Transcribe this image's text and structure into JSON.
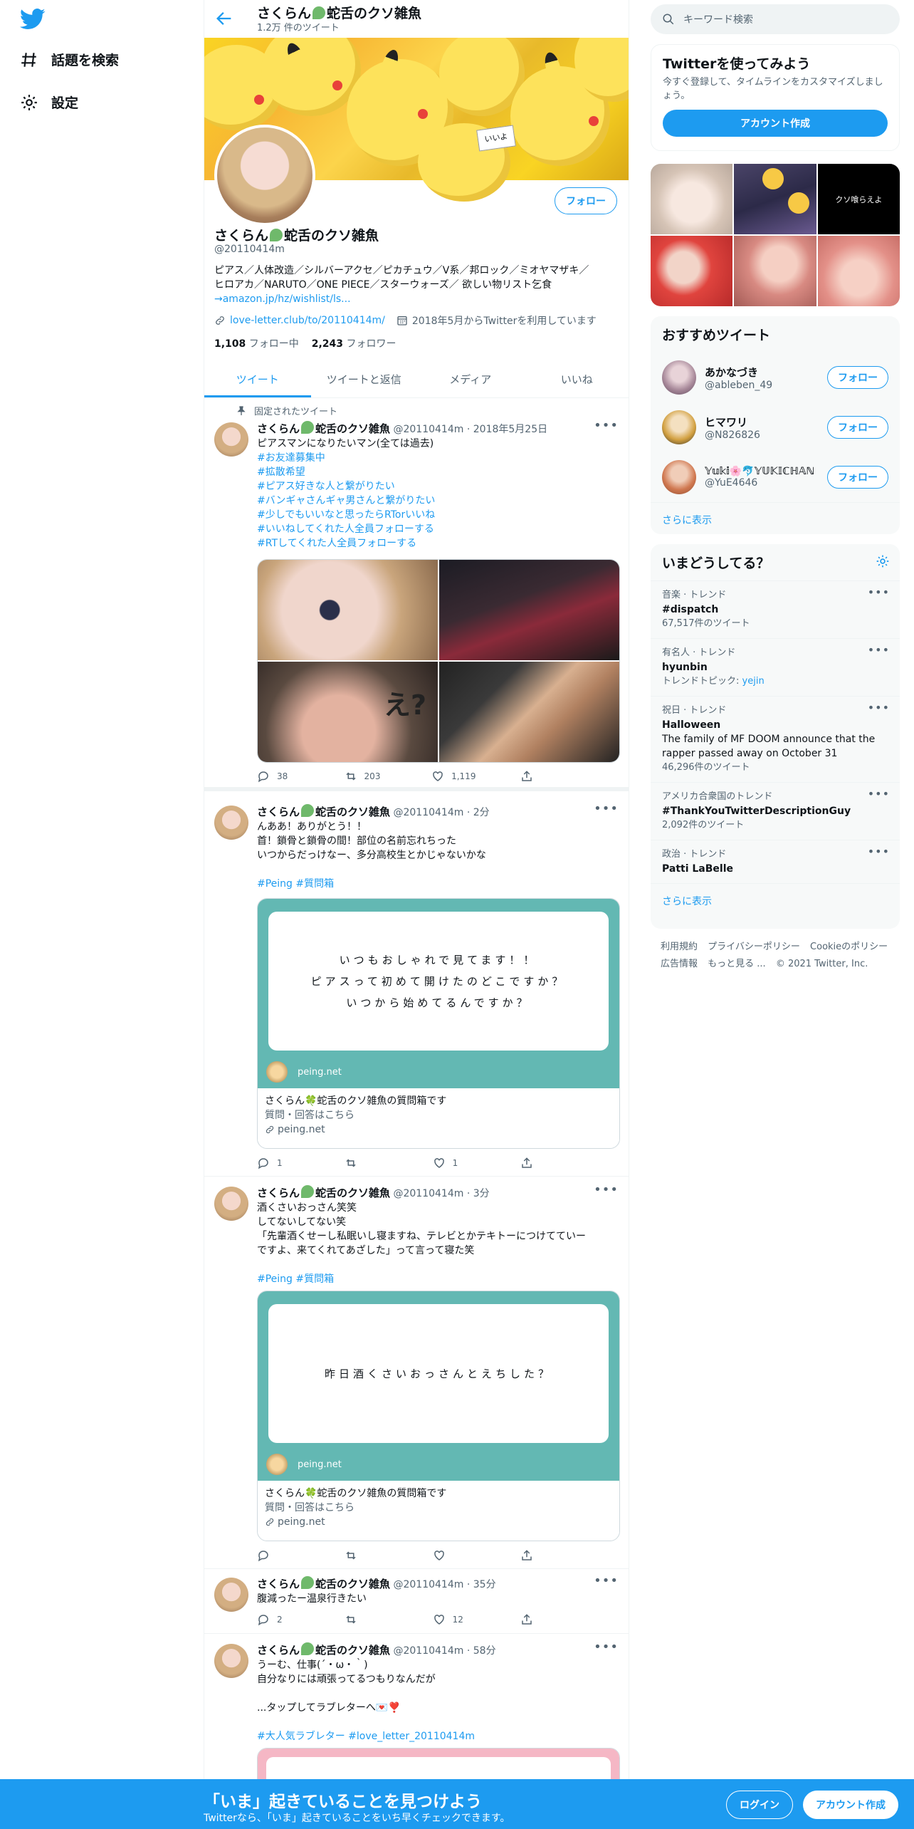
{
  "left_nav": {
    "items": [
      {
        "label": "話題を検索",
        "icon": "hashtag-icon"
      },
      {
        "label": "設定",
        "icon": "gear-icon"
      }
    ]
  },
  "profile": {
    "header_name": "さくらん🍀蛇舌のクソ雑魚",
    "name_prefix": "さくらん",
    "name_suffix": "蛇舌のクソ雑魚",
    "tweet_count": "1.2万 件のツイート",
    "handle": "@20110414m",
    "follow_label": "フォロー",
    "bio_line1": "ピアス／人体改造／シルバーアクセ／ピカチュウ／V系／邦ロック／ミオヤマザキ／",
    "bio_line2": "ヒロアカ／NARUTO／ONE PIECE／スターウォーズ／ 欲しい物リスト乞食",
    "bio_link": "→amazon.jp/hz/wishlist/ls...",
    "website": "love-letter.club/to/20110414m/",
    "joined": "2018年5月からTwitterを利用しています",
    "following_count": "1,108",
    "following_label": "フォロー中",
    "followers_count": "2,243",
    "followers_label": "フォロワー",
    "banner_note": "いいよ"
  },
  "tabs": [
    "ツイート",
    "ツイートと返信",
    "メディア",
    "いいね"
  ],
  "tweets": [
    {
      "pinned_label": "固定されたツイート",
      "handle": "@20110414m",
      "time": "2018年5月25日",
      "lines": [
        "ピアスマンになりたいマン(全ては過去)"
      ],
      "tags": [
        "#お友達募集中",
        "#拡散希望",
        "#ピアス好きな人と繋がりたい",
        "#バンギャさんギャ男さんと繋がりたい",
        "#少しでもいいなと思ったらRTorいいね",
        "#いいねしてくれた人全員フォローする",
        "#RTしてくれた人全員フォローする"
      ],
      "media_overlay": "え?",
      "reply": "38",
      "retweet": "203",
      "like": "1,119"
    },
    {
      "handle": "@20110414m",
      "time": "2分",
      "lines": [
        "んああ！ありがとう！！",
        "首！鎖骨と鎖骨の間！部位の名前忘れちった",
        "いつからだっけなー、多分高校生とかじゃないかな"
      ],
      "tagline": "#Peing #質問箱",
      "card_lines": [
        "いつもおしゃれで見てます！！",
        "ピアスって初めて開けたのどこですか？",
        "いつから始めてるんですか？"
      ],
      "card_site": "peing.net",
      "card_title": "さくらん🍀蛇舌のクソ雑魚の質問箱です",
      "card_desc": "質問・回答はこちら",
      "card_domain": "peing.net",
      "reply": "1",
      "retweet": "",
      "like": "1"
    },
    {
      "handle": "@20110414m",
      "time": "3分",
      "lines": [
        "酒くさいおっさん笑笑",
        "してないしてない笑",
        "「先輩酒くせーし私眠いし寝ますね、テレビとかテキトーにつけてていー",
        "ですよ、来てくれてあざした」って言って寝た笑"
      ],
      "tagline": "#Peing #質問箱",
      "card_lines": [
        "昨日酒くさいおっさんとえちした？"
      ],
      "card_site": "peing.net",
      "card_title": "さくらん🍀蛇舌のクソ雑魚の質問箱です",
      "card_desc": "質問・回答はこちら",
      "card_domain": "peing.net",
      "reply": "",
      "retweet": "",
      "like": ""
    },
    {
      "handle": "@20110414m",
      "time": "35分",
      "lines": [
        "腹減ったー温泉行きたい"
      ],
      "reply": "2",
      "retweet": "",
      "like": "12"
    },
    {
      "handle": "@20110414m",
      "time": "58分",
      "lines": [
        "うーむ、仕事(´・ω・｀)",
        "自分なりには頑張ってるつもりなんだが",
        "",
        "...タップしてラブレターへ💌❣️"
      ],
      "tagline": "#大人気ラブレター #love_letter_20110414m"
    }
  ],
  "right": {
    "search_placeholder": "キーワード検索",
    "signup_box": {
      "title": "Twitterを使ってみよう",
      "desc": "今すぐ登録して、タイムラインをカスタマイズしましょう。",
      "button": "アカウント作成"
    },
    "media_caption": "クソ喰らえよ",
    "who_title": "おすすめツイート",
    "who": [
      {
        "name": "あかなづき",
        "handle": "@ableben_49",
        "button": "フォロー"
      },
      {
        "name": "ヒマワリ",
        "handle": "@N826826",
        "button": "フォロー"
      },
      {
        "name": "𝕐𝕦𝕜𝕚🌸🐬𝕐𝕌𝕂𝕀ℂℍ𝔸ℕ",
        "handle": "@YuE4646",
        "button": "フォロー"
      }
    ],
    "who_more": "さらに表示",
    "trends_title": "いまどうしてる？",
    "trends": [
      {
        "context": "音楽 · トレンド",
        "name": "#dispatch",
        "sub": "67,517件のツイート"
      },
      {
        "context": "有名人 · トレンド",
        "name": "hyunbin",
        "sub_label": "トレンドトピック:",
        "sub_link": "yejin"
      },
      {
        "context": "祝日 · トレンド",
        "name": "Halloween",
        "desc": "The family of MF DOOM announce that the rapper passed away on October 31",
        "sub": "46,296件のツイート"
      },
      {
        "context": "アメリカ合衆国のトレンド",
        "name": "#ThankYouTwitterDescriptionGuy",
        "sub": "2,092件のツイート"
      },
      {
        "context": "政治 · トレンド",
        "name": "Patti LaBelle"
      }
    ],
    "trends_more": "さらに表示",
    "footer_links": [
      "利用規約",
      "プライバシーポリシー",
      "Cookieのポリシー",
      "広告情報",
      "もっと見る ..."
    ],
    "copyright": "© 2021 Twitter, Inc."
  },
  "bottom_bar": {
    "title": "「いま」起きていることを見つけよう",
    "subtitle": "Twitterなら、「いま」起きていることをいち早くチェックできます。",
    "login": "ログイン",
    "signup": "アカウント作成"
  },
  "colors": {
    "accent": "#1d9bf0",
    "muted": "#536471",
    "peing": "#63b8b3",
    "bottom_bar": "#1d9bf0"
  }
}
